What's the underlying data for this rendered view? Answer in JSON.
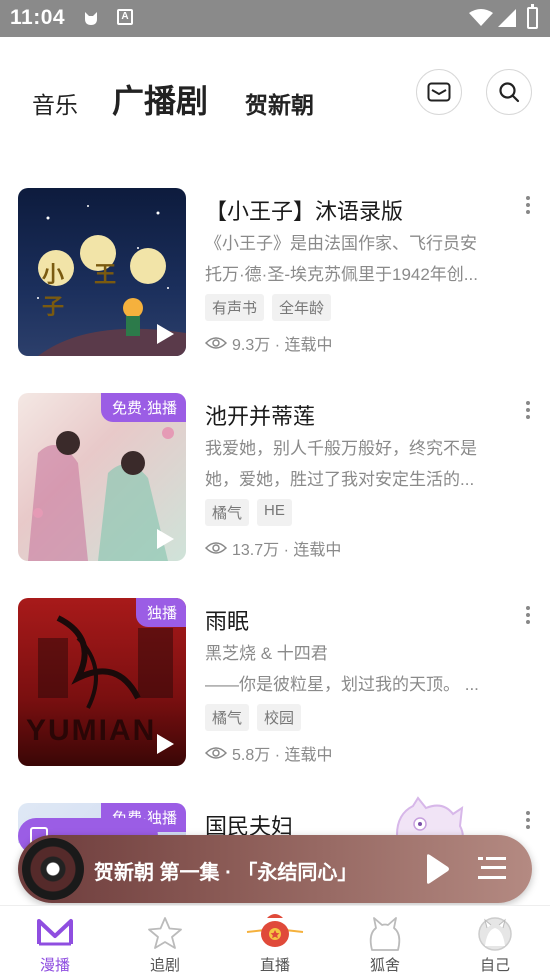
{
  "status_bar": {
    "time": "11:04"
  },
  "top_tabs": {
    "music": "音乐",
    "radio_drama": "广播剧",
    "author": "贺新朝"
  },
  "items": [
    {
      "title": "【小王子】沐语录版",
      "desc_line1": "《小王子》是由法国作家、飞行员安",
      "desc_line2": "托万·德·圣-埃克苏佩里于1942年创...",
      "tags": [
        "有声书",
        "全年龄"
      ],
      "plays": "9.3万 · 连载中",
      "badge": "",
      "cover_text": "小 王 子"
    },
    {
      "title": "池开并蒂莲",
      "desc_line1": "我爱她，别人千般万般好，终究不是",
      "desc_line2": "她，爱她，胜过了我对安定生活的...",
      "tags": [
        "橘气",
        "HE"
      ],
      "plays": "13.7万 · 连载中",
      "badge": "免费·独播"
    },
    {
      "title": "雨眠",
      "desc_line1": "黑芝烧 & 十四君",
      "desc_line2": "——你是彼粒星，划过我的天顶。 ...",
      "tags": [
        "橘气",
        "校园"
      ],
      "plays": "5.8万 · 连载中",
      "badge": "独播",
      "cover_text": "YUMIAN"
    },
    {
      "title": "国民夫妇",
      "badge": "免费·独播"
    }
  ],
  "player": {
    "title": "贺新朝 第一集 · 「永结同心」"
  },
  "bottom_nav": [
    {
      "label": "漫播",
      "active": true
    },
    {
      "label": "追剧",
      "active": false
    },
    {
      "label": "直播",
      "active": false
    },
    {
      "label": "狐舍",
      "active": false
    },
    {
      "label": "自己",
      "active": false
    }
  ],
  "colors": {
    "accent": "#9b5de5",
    "nav_active": "#8f4ee0",
    "status_bar": "#8a8a8a"
  }
}
